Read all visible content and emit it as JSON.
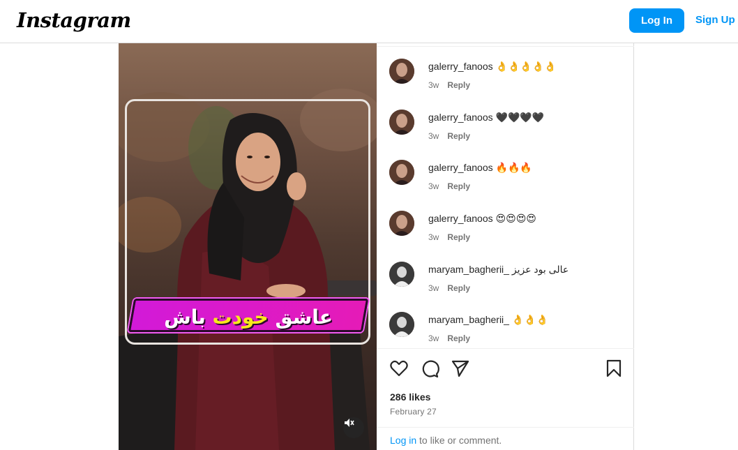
{
  "header": {
    "logo": "Instagram",
    "login_label": "Log In",
    "signup_label": "Sign Up"
  },
  "media": {
    "banner_text_part1": "عاشق",
    "banner_text_highlight": "خودت",
    "banner_text_part2": "باش",
    "mute_icon": "volume-mute-icon"
  },
  "comments": [
    {
      "user": "galerry_fanoos",
      "text": "👌👌👌👌👌",
      "time": "3w",
      "reply": "Reply"
    },
    {
      "user": "galerry_fanoos",
      "text": "🖤🖤🖤🖤",
      "time": "3w",
      "reply": "Reply"
    },
    {
      "user": "galerry_fanoos",
      "text": "🔥🔥🔥",
      "time": "3w",
      "reply": "Reply"
    },
    {
      "user": "galerry_fanoos",
      "text": "😍😍😍😍",
      "time": "3w",
      "reply": "Reply"
    },
    {
      "user": "maryam_bagherii_",
      "text": "عالی بود عزیز",
      "time": "3w",
      "reply": "Reply"
    },
    {
      "user": "maryam_bagherii_",
      "text": "👌👌👌",
      "time": "3w",
      "reply": "Reply"
    }
  ],
  "post": {
    "likes": "286 likes",
    "date": "February 27",
    "cta_link": "Log in",
    "cta_rest": " to like or comment."
  },
  "colors": {
    "accent": "#0095f6",
    "banner": "#e51bb7",
    "banner_highlight": "#f8e71c"
  }
}
